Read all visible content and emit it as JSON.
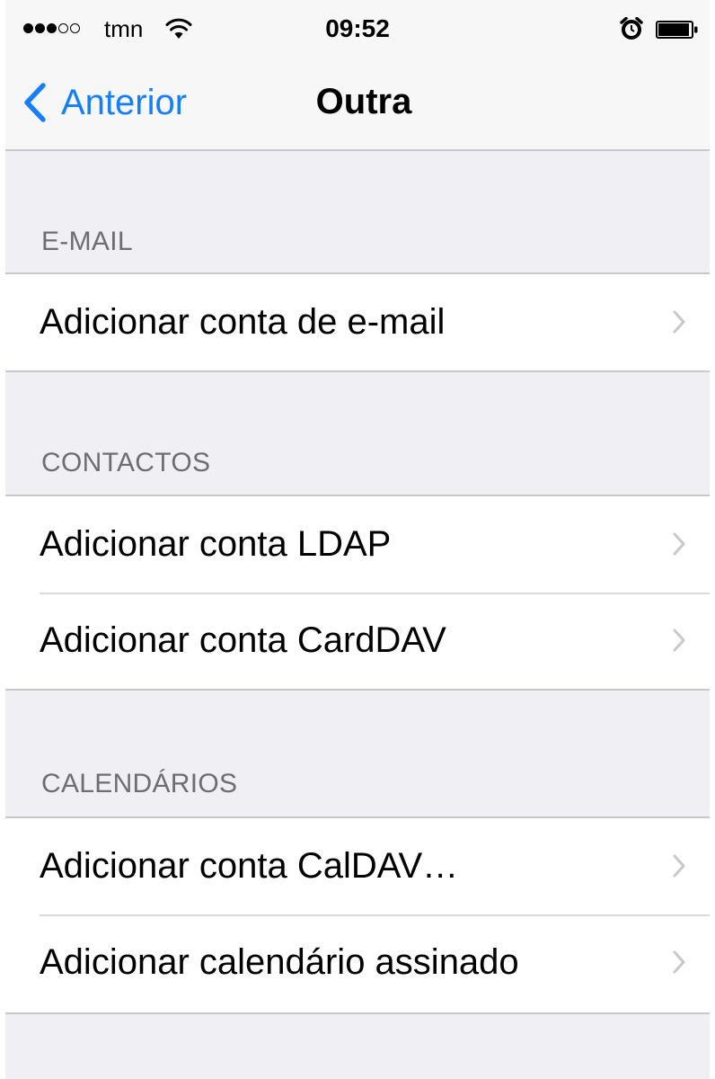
{
  "status_bar": {
    "carrier": "tmn",
    "time": "09:52",
    "signal": {
      "filled": 3,
      "total": 5
    },
    "icons": [
      "signal-dots-icon",
      "wifi-icon",
      "alarm-clock-icon",
      "battery-icon"
    ]
  },
  "nav": {
    "back_label": "Anterior",
    "title": "Outra"
  },
  "sections": [
    {
      "header": "E-MAIL",
      "rows": [
        {
          "label": "Adicionar conta de e-mail"
        }
      ]
    },
    {
      "header": "CONTACTOS",
      "rows": [
        {
          "label": "Adicionar conta LDAP"
        },
        {
          "label": "Adicionar conta CardDAV"
        }
      ]
    },
    {
      "header": "CALENDÁRIOS",
      "rows": [
        {
          "label": "Adicionar conta CalDAV…"
        },
        {
          "label": "Adicionar calendário assinado"
        }
      ]
    }
  ],
  "colors": {
    "accent": "#157efb",
    "background": "#efeff4",
    "section_header": "#6d6d72",
    "separator": "#c8c7cc",
    "chevron": "#c7c7cc"
  }
}
